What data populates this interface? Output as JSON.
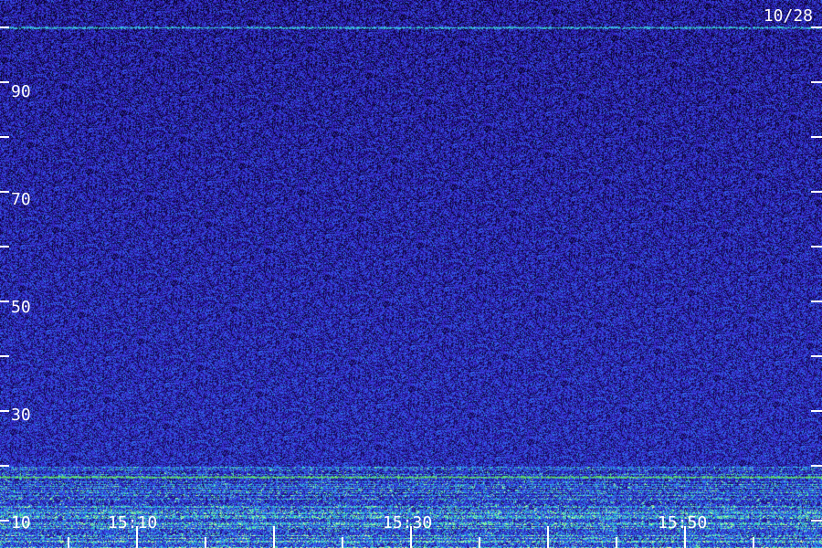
{
  "chart_data": {
    "type": "heatmap",
    "title": "",
    "date_label": "10/28",
    "xlabel": "",
    "ylabel": "",
    "x_tick_labels": [
      "15:10",
      "15:30",
      "15:50"
    ],
    "y_tick_labels": [
      "10",
      "30",
      "50",
      "70",
      "90"
    ],
    "ylim": [
      5,
      105
    ],
    "colormap": [
      "#000000",
      "#1a0a6e",
      "#3b2ad6",
      "#2f6cf0",
      "#29c7e8",
      "#5ef08a",
      "#e8ffb0"
    ],
    "features": [
      {
        "kind": "persistent_line",
        "y": 100,
        "color": "#41d9f5"
      },
      {
        "kind": "persistent_line",
        "y": 18,
        "color": "#6af07c"
      },
      {
        "kind": "broadband_noise_floor",
        "y_max": 20
      }
    ]
  }
}
